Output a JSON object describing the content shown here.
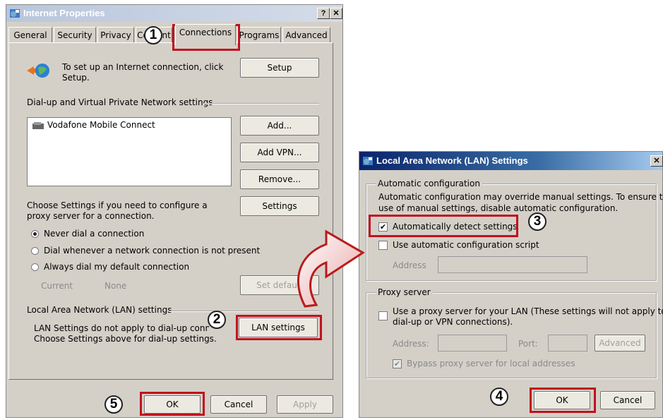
{
  "internet_properties": {
    "title": "Internet Properties",
    "help_btn": "?",
    "close_btn": "✕",
    "tabs": [
      "General",
      "Security",
      "Privacy",
      "Content",
      "Connections",
      "Programs",
      "Advanced"
    ],
    "setup_text": "To set up an Internet connection, click Setup.",
    "setup_btn": "Setup",
    "dialup_heading": "Dial-up and Virtual Private Network settings",
    "connections_list": [
      "Vodafone Mobile Connect"
    ],
    "add_btn": "Add...",
    "add_vpn_btn": "Add VPN...",
    "remove_btn": "Remove...",
    "proxy_text": "Choose Settings if you need to configure a proxy server for a connection.",
    "settings_btn": "Settings",
    "radio_never": "Never dial a connection",
    "radio_whenever": "Dial whenever a network connection is not present",
    "radio_always": "Always dial my default connection",
    "current_label": "Current",
    "current_value": "None",
    "set_default_btn": "Set default",
    "lan_heading": "Local Area Network (LAN) settings",
    "lan_text_1": "LAN Settings do not apply to dial-up connections.",
    "lan_text_2": "Choose Settings above for dial-up settings.",
    "lan_settings_btn": "LAN settings",
    "ok_btn": "OK",
    "cancel_btn": "Cancel",
    "apply_btn": "Apply"
  },
  "lan_dialog": {
    "title": "Local Area Network (LAN) Settings",
    "close_btn": "✕",
    "auto_group": "Automatic configuration",
    "auto_text_1": "Automatic configuration may override manual settings.  To ensure the",
    "auto_text_2": "use of manual settings, disable automatic configuration.",
    "auto_detect": "Automatically detect settings",
    "auto_script": "Use automatic configuration script",
    "address_label": "Address",
    "proxy_group": "Proxy server",
    "use_proxy_1": "Use a proxy server for your LAN (These settings will not apply to",
    "use_proxy_2": "dial-up or VPN connections).",
    "proxy_address_label": "Address:",
    "port_label": "Port:",
    "advanced_btn": "Advanced",
    "bypass": "Bypass proxy server for local addresses",
    "ok_btn": "OK",
    "cancel_btn": "Cancel"
  },
  "callouts": [
    "1",
    "2",
    "3",
    "4",
    "5"
  ],
  "colors": {
    "highlight": "#c0121e",
    "titlebar": "#0a246a"
  }
}
